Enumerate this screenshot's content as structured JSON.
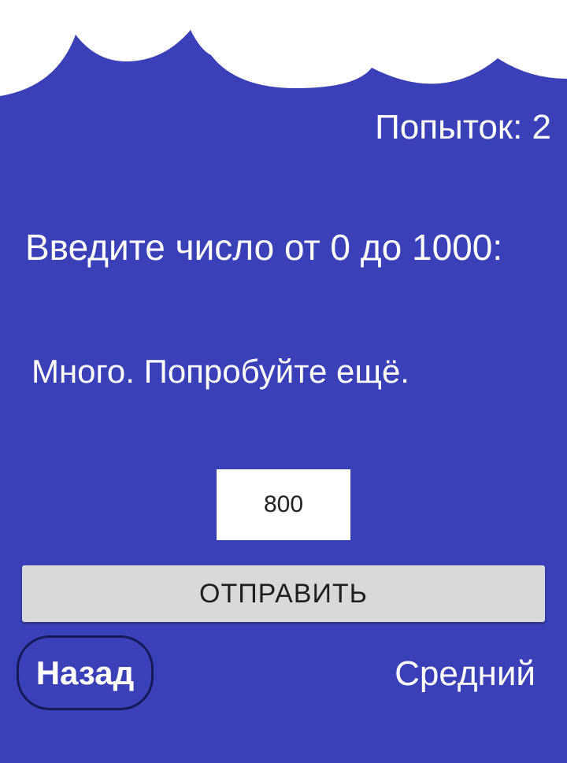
{
  "header": {
    "attempts_text": "Попыток: 2"
  },
  "game": {
    "prompt": "Введите число от 0 до 1000:",
    "feedback": "Много. Попробуйте ещё.",
    "input_value": "800",
    "submit_label": "ОТПРАВИТЬ"
  },
  "footer": {
    "back_label": "Назад",
    "difficulty_label": "Средний"
  },
  "colors": {
    "background": "#3a41b8",
    "cloud": "#ffffff",
    "button": "#d8d9d8"
  }
}
